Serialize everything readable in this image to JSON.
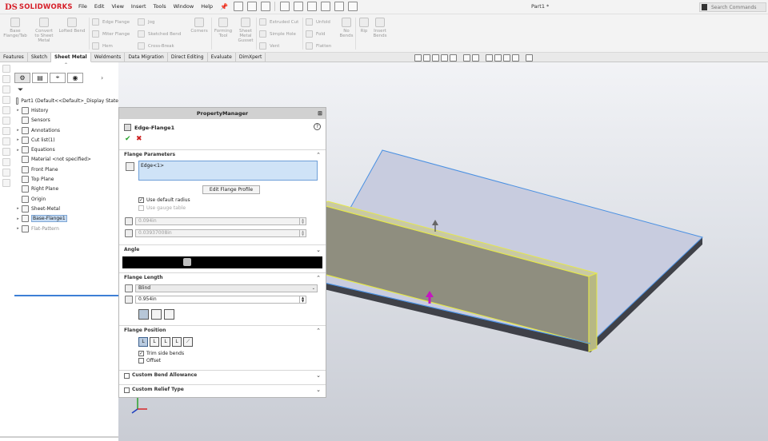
{
  "app": {
    "brand_mark": "DS",
    "brand_name": "SOLIDWORKS",
    "document_title": "Part1 *",
    "search_placeholder": "Search Commands"
  },
  "menu": [
    "File",
    "Edit",
    "View",
    "Insert",
    "Tools",
    "Window",
    "Help"
  ],
  "ribbon": {
    "large_buttons": [
      {
        "label": "Base\nFlange/Tab",
        "icon": "base-flange-icon"
      },
      {
        "label": "Convert\nto Sheet\nMetal",
        "icon": "convert-sheet-metal-icon"
      },
      {
        "label": "Lofted Bend",
        "icon": "lofted-bend-icon"
      }
    ],
    "group1": [
      "Edge Flange",
      "Miter Flange",
      "Hem"
    ],
    "group2": [
      "Jog",
      "Sketched Bend",
      "Cross-Break"
    ],
    "corners": "Corners",
    "forming": [
      "Forming\nTool",
      "Sheet\nMetal\nGusset"
    ],
    "group3": [
      "Extruded Cut",
      "Simple Hole",
      "Vent"
    ],
    "group4": [
      "Unfold",
      "Fold",
      "Flatten"
    ],
    "no_bends": "No\nBends",
    "rip": "Rip",
    "insert_bends": "Insert\nBends"
  },
  "tabs": [
    {
      "label": "Features",
      "active": false
    },
    {
      "label": "Sketch",
      "active": false
    },
    {
      "label": "Sheet Metal",
      "active": true
    },
    {
      "label": "Weldments",
      "active": false
    },
    {
      "label": "Data Migration",
      "active": false
    },
    {
      "label": "Direct Editing",
      "active": false
    },
    {
      "label": "Evaluate",
      "active": false
    },
    {
      "label": "DimXpert",
      "active": false
    }
  ],
  "tree": [
    {
      "label": "Part1  (Default<<Default>_Display State",
      "arrow": "",
      "icon": "part-icon",
      "state": "normal"
    },
    {
      "label": "History",
      "arrow": "▸",
      "icon": "history-icon",
      "state": "normal"
    },
    {
      "label": "Sensors",
      "arrow": "",
      "icon": "sensors-icon",
      "state": "normal"
    },
    {
      "label": "Annotations",
      "arrow": "▸",
      "icon": "annotations-icon",
      "state": "normal"
    },
    {
      "label": "Cut list(1)",
      "arrow": "▸",
      "icon": "cut-list-icon",
      "state": "normal"
    },
    {
      "label": "Equations",
      "arrow": "▸",
      "icon": "equations-icon",
      "state": "normal"
    },
    {
      "label": "Material <not specified>",
      "arrow": "",
      "icon": "material-icon",
      "state": "normal"
    },
    {
      "label": "Front Plane",
      "arrow": "",
      "icon": "plane-icon",
      "state": "normal"
    },
    {
      "label": "Top Plane",
      "arrow": "",
      "icon": "plane-icon",
      "state": "normal"
    },
    {
      "label": "Right Plane",
      "arrow": "",
      "icon": "plane-icon",
      "state": "normal"
    },
    {
      "label": "Origin",
      "arrow": "",
      "icon": "origin-icon",
      "state": "normal"
    },
    {
      "label": "Sheet-Metal",
      "arrow": "▸",
      "icon": "sheet-metal-icon",
      "state": "normal"
    },
    {
      "label": "Base-Flange1",
      "arrow": "▸",
      "icon": "base-flange-icon",
      "state": "selected"
    },
    {
      "label": "Flat-Pattern",
      "arrow": "▸",
      "icon": "flat-pattern-icon",
      "state": "dim"
    }
  ],
  "pm": {
    "title": "PropertyManager",
    "feature_name": "Edge-Flange1",
    "help": "?",
    "ok": "✔",
    "cancel": "✖",
    "sections": {
      "flange_parameters": "Flange Parameters",
      "angle": "Angle",
      "flange_length": "Flange Length",
      "flange_position": "Flange Position",
      "custom_bend": "Custom Bend Allowance",
      "custom_relief": "Custom Relief Type"
    },
    "edge_selection": "Edge<1>",
    "edit_profile_button": "Edit Flange Profile",
    "use_default_radius": "Use default radius",
    "use_gauge_table": "Use gauge table",
    "radius_value": "0.094in",
    "thickness_value": "0.03937008in",
    "end_condition": "Blind",
    "length_value": "0.954in",
    "trim_side_bends": "Trim side bends",
    "offset": "Offset"
  },
  "colors": {
    "brand": "#d6202a",
    "selection_fill": "#cfe3f7",
    "selection_border": "#6e9fd8",
    "model_edge": "#4a90e2",
    "flange_highlight": "#e5e84a",
    "drag_handle": "#c516c0"
  }
}
